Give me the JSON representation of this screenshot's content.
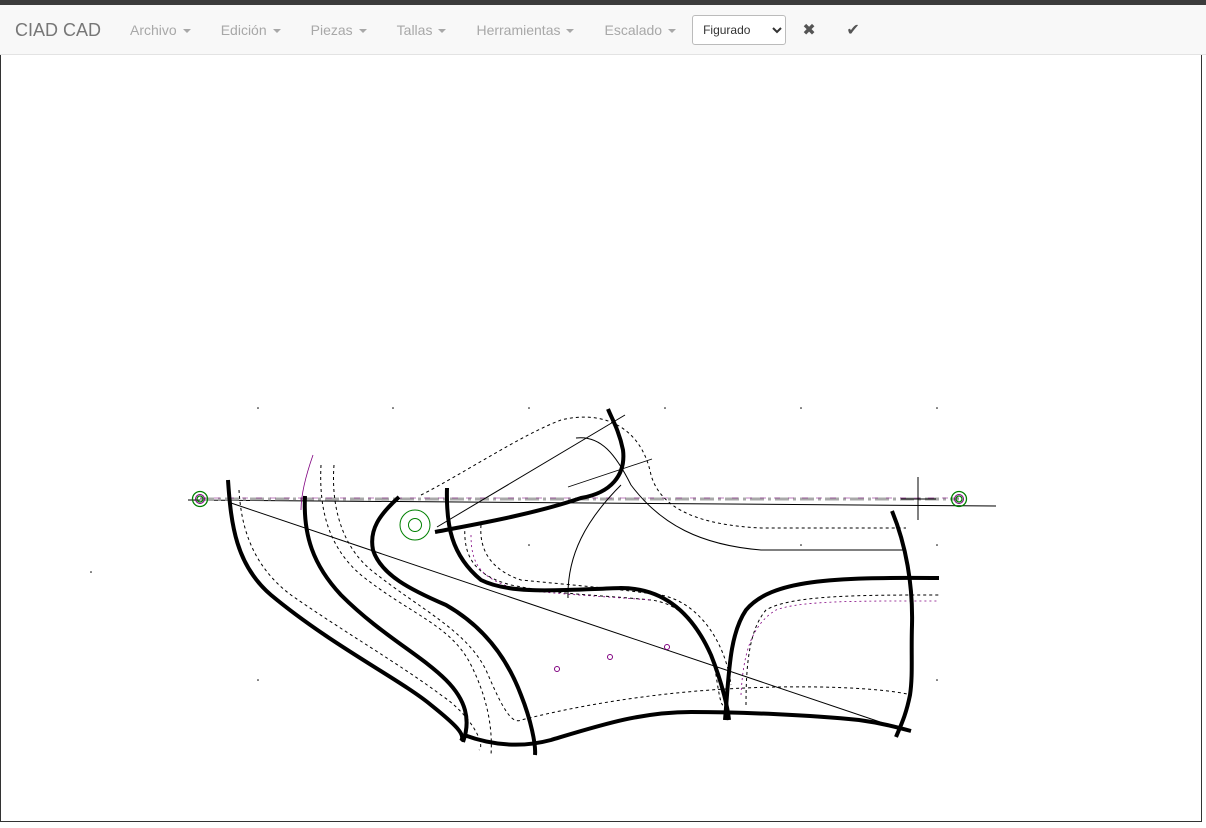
{
  "app": {
    "title": "CIAD CAD"
  },
  "menu": {
    "items": [
      {
        "label": "Archivo"
      },
      {
        "label": "Edición"
      },
      {
        "label": "Piezas"
      },
      {
        "label": "Tallas"
      },
      {
        "label": "Herramientas"
      },
      {
        "label": "Escalado"
      }
    ]
  },
  "toolbar": {
    "mode_select": {
      "selected": "Figurado"
    },
    "cancel_icon": "close-icon",
    "confirm_icon": "check-icon"
  },
  "canvas": {
    "description_icon": "shoe-pattern-drawing",
    "colors": {
      "outline": "#000000",
      "marker": "#008000",
      "axis": "#a9a9a9",
      "point": "#800080"
    }
  }
}
